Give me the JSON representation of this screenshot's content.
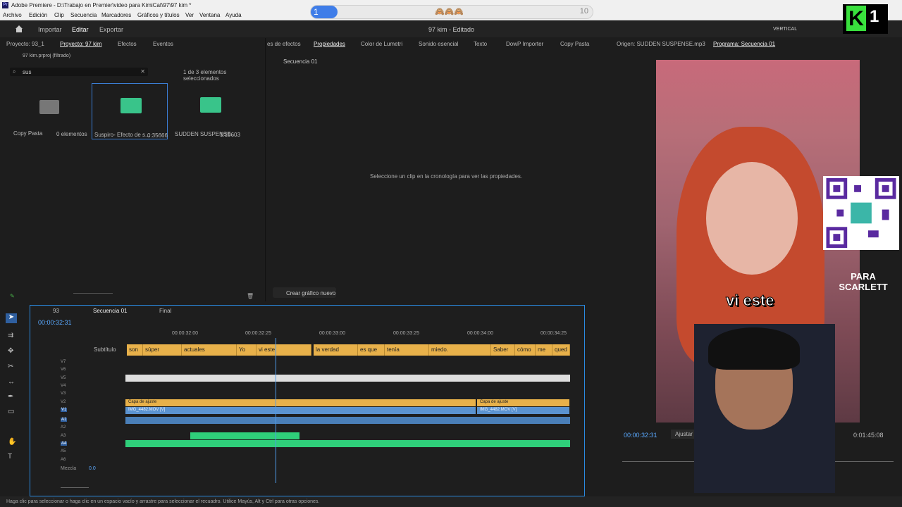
{
  "window": {
    "title": "Adobe Premiere - D:\\Trabajo en Premier\\video para KimiCat\\97\\97 kim *"
  },
  "menu": [
    "Archivo",
    "Edición",
    "Clip",
    "Secuencia",
    "Marcadores",
    "Gráficos y títulos",
    "Ver",
    "Ventana",
    "Ayuda"
  ],
  "overlay": {
    "left": "1",
    "right": "10",
    "mid": "🙈🙈🙈"
  },
  "appbar": {
    "import": "Importar",
    "edit": "Editar",
    "export": "Exportar",
    "title": "97 kim - Editado",
    "vertical": "VERTICAL"
  },
  "brand": {
    "k": "K",
    "one": "1"
  },
  "project": {
    "tab1": "Proyecto: 93_1",
    "tab2": "Proyecto: 97 kim",
    "tab3": "Efectos",
    "tab4": "Eventos",
    "file": "97 kim.prproj (filtrado)",
    "search": "sus",
    "selected": "1 de 3 elementos seleccionados",
    "items": [
      {
        "name": "Copy Pasta",
        "meta": "0 elementos"
      },
      {
        "name": "Suspiro- Efecto de s...",
        "meta": "0:35666"
      },
      {
        "name": "SUDDEN SUSPENSE...",
        "meta": "1:19603"
      }
    ]
  },
  "effects": {
    "tabs": [
      "es de efectos",
      "Propiedades",
      "Color de Lumetri",
      "Sonido esencial",
      "Texto",
      "DowP Importer",
      "Copy Pasta"
    ],
    "sequence": "Secuencia 01",
    "message": "Seleccione un clip en la cronología para ver las propiedades.",
    "button": "Crear gráfico nuevo"
  },
  "program": {
    "source": "Origen: SUDDEN SUSPENSE.mp3",
    "program": "Programa: Secuencia 01",
    "timecode": "00:00:32:31",
    "fit": "Ajustar",
    "duration": "0:01:45:08",
    "subtitle": "vi este",
    "sticker": "PARA SCARLETT"
  },
  "timeline": {
    "tabs": [
      "93",
      "Secuencia 01",
      "Final"
    ],
    "timecode": "00:00:32:31",
    "ruler": [
      "00:00:32:00",
      "00:00:32:25",
      "00:00:33:00",
      "00:00:33:25",
      "00:00:34:00",
      "00:00:34:25"
    ],
    "subtitle_track": "Subtítulo",
    "subtitles": [
      "son",
      "súper",
      "actuales",
      "Yo",
      "vi este",
      "la verdad",
      "es que",
      "tenía",
      "miedo.",
      "Saber",
      "cómo",
      "me",
      "qued"
    ],
    "video_tracks": [
      "V7",
      "V6",
      "V5",
      "V4",
      "V3",
      "V2",
      "V1"
    ],
    "audio_tracks": [
      "A1",
      "A2",
      "A3",
      "A4",
      "A5",
      "A6"
    ],
    "mix": "Mezcla",
    "mix_val": "0.0",
    "clip_adjust": "Capa de ajuste",
    "clip_video": "IMG_4482.MOV [V]"
  },
  "status": "Haga clic para seleccionar o haga clic en un espacio vacío y arrastre para seleccionar el recuadro. Utilice Mayús, Alt y Ctrl para otras opciones."
}
